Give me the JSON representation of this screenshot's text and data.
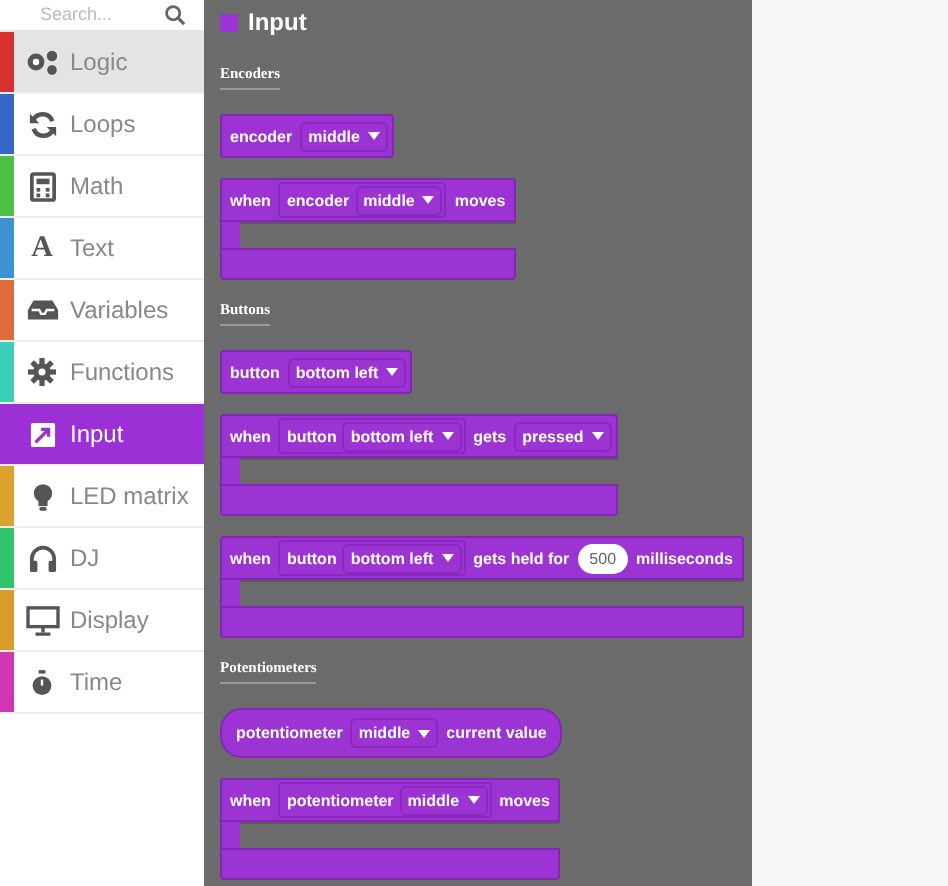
{
  "sidebar": {
    "search": {
      "placeholder": "Search..."
    },
    "items": [
      {
        "label": "Logic",
        "color": "#d7312f",
        "selected": false,
        "hovered": true
      },
      {
        "label": "Loops",
        "color": "#3465c9",
        "selected": false,
        "hovered": false
      },
      {
        "label": "Math",
        "color": "#4cbf44",
        "selected": false,
        "hovered": false
      },
      {
        "label": "Text",
        "color": "#3b92d3",
        "selected": false,
        "hovered": false,
        "glyph": "A"
      },
      {
        "label": "Variables",
        "color": "#dd6c3a",
        "selected": false,
        "hovered": false
      },
      {
        "label": "Functions",
        "color": "#3ccfb8",
        "selected": false,
        "hovered": false
      },
      {
        "label": "Input",
        "color": "#9b30d6",
        "selected": true,
        "hovered": false
      },
      {
        "label": "LED matrix",
        "color": "#dca22e",
        "selected": false,
        "hovered": false
      },
      {
        "label": "DJ",
        "color": "#2fc36b",
        "selected": false,
        "hovered": false
      },
      {
        "label": "Display",
        "color": "#d99b2a",
        "selected": false,
        "hovered": false
      },
      {
        "label": "Time",
        "color": "#cf36b3",
        "selected": false,
        "hovered": false
      }
    ]
  },
  "flyout": {
    "title": "Input",
    "entries": [
      {
        "kind": "label",
        "text": "Encoders"
      },
      {
        "kind": "value",
        "parts": [
          {
            "kind": "text",
            "text": "encoder"
          },
          {
            "kind": "dropdown",
            "text": "middle"
          }
        ]
      },
      {
        "kind": "event",
        "parts": [
          {
            "kind": "text",
            "text": "when"
          },
          {
            "kind": "group",
            "parts": [
              {
                "kind": "text",
                "text": "encoder"
              },
              {
                "kind": "dropdown",
                "text": "middle"
              }
            ]
          },
          {
            "kind": "text",
            "text": "moves"
          }
        ]
      },
      {
        "kind": "label",
        "text": "Buttons"
      },
      {
        "kind": "value",
        "parts": [
          {
            "kind": "text",
            "text": "button"
          },
          {
            "kind": "dropdown",
            "text": "bottom left"
          }
        ]
      },
      {
        "kind": "event",
        "parts": [
          {
            "kind": "text",
            "text": "when"
          },
          {
            "kind": "group",
            "parts": [
              {
                "kind": "text",
                "text": "button"
              },
              {
                "kind": "dropdown",
                "text": "bottom left"
              }
            ]
          },
          {
            "kind": "text",
            "text": "gets"
          },
          {
            "kind": "dropdown",
            "text": "pressed"
          }
        ]
      },
      {
        "kind": "event",
        "parts": [
          {
            "kind": "text",
            "text": "when"
          },
          {
            "kind": "group",
            "parts": [
              {
                "kind": "text",
                "text": "button"
              },
              {
                "kind": "dropdown",
                "text": "bottom left"
              }
            ]
          },
          {
            "kind": "text",
            "text": "gets held for"
          },
          {
            "kind": "number",
            "text": "500"
          },
          {
            "kind": "text",
            "text": "milliseconds"
          }
        ]
      },
      {
        "kind": "label",
        "text": "Potentiometers"
      },
      {
        "kind": "reporter",
        "parts": [
          {
            "kind": "text",
            "text": "potentiometer"
          },
          {
            "kind": "dropdown",
            "text": "middle"
          },
          {
            "kind": "text",
            "text": "current value"
          }
        ]
      },
      {
        "kind": "event",
        "parts": [
          {
            "kind": "text",
            "text": "when"
          },
          {
            "kind": "group",
            "parts": [
              {
                "kind": "text",
                "text": "potentiometer"
              },
              {
                "kind": "dropdown",
                "text": "middle"
              }
            ]
          },
          {
            "kind": "text",
            "text": "moves"
          }
        ]
      }
    ]
  }
}
